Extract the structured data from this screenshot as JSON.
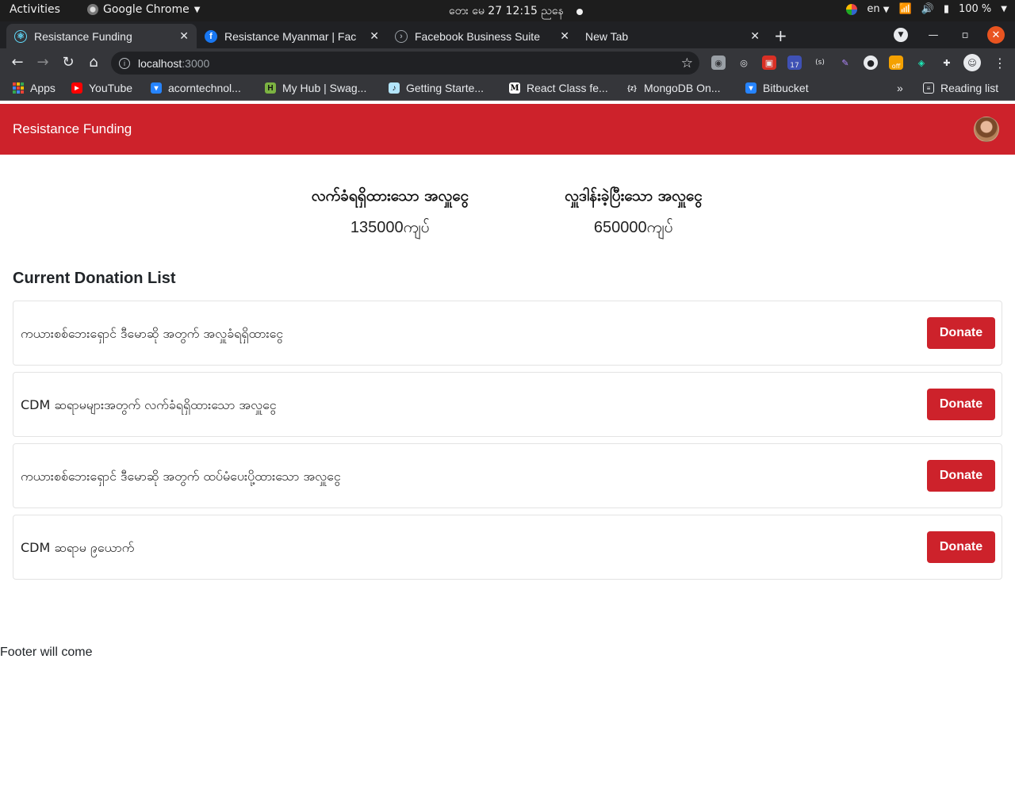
{
  "system_bar": {
    "activities": "Activities",
    "app_name": "Google Chrome",
    "clock": "တေး မေ 27  12:15 ညနေ",
    "language": "en",
    "battery": "100 %"
  },
  "tabs": [
    {
      "title": "Resistance Funding",
      "active": true
    },
    {
      "title": "Resistance Myanmar | Fac",
      "active": false
    },
    {
      "title": "Facebook Business Suite",
      "active": false
    },
    {
      "title": "New Tab",
      "active": false
    }
  ],
  "address_bar": {
    "host": "localhost",
    "port": ":3000"
  },
  "extensions": {
    "badge_count": "17",
    "off_badge": "off"
  },
  "bookmarks": [
    {
      "label": "Apps"
    },
    {
      "label": "YouTube"
    },
    {
      "label": "acorntechnol..."
    },
    {
      "label": "My Hub | Swag..."
    },
    {
      "label": "Getting Starte..."
    },
    {
      "label": "React Class fe..."
    },
    {
      "label": "MongoDB On..."
    },
    {
      "label": "Bitbucket"
    }
  ],
  "bookmarks_overflow": "»",
  "reading_list": "Reading list",
  "app": {
    "brand": "Resistance Funding",
    "stats": [
      {
        "label": "လက်ခံရရှိထားသော အလှူငွေ",
        "value": "135000ကျပ်"
      },
      {
        "label": "လှူဒါန်းခဲ့ပြီးသော အလှူငွေ",
        "value": "650000ကျပ်"
      }
    ],
    "section_title": "Current Donation List",
    "donations": [
      {
        "text": "ကယားစစ်ဘေးရှောင် ဒီမောဆို အတွက် အလှူခံရရှိထားငွေ",
        "button": "Donate"
      },
      {
        "text": "CDM ဆရာမများအတွက် လက်ခံရရှိထားသော အလှူငွေ",
        "button": "Donate"
      },
      {
        "text": "ကယားစစ်ဘေးရှောင် ဒီမောဆို အတွက် ထပ်မံပေးပို့ထားသော အလှူငွေ",
        "button": "Donate"
      },
      {
        "text": "CDM ဆရာမ ၉ယောက်",
        "button": "Donate"
      }
    ],
    "footer": "Footer will come"
  }
}
